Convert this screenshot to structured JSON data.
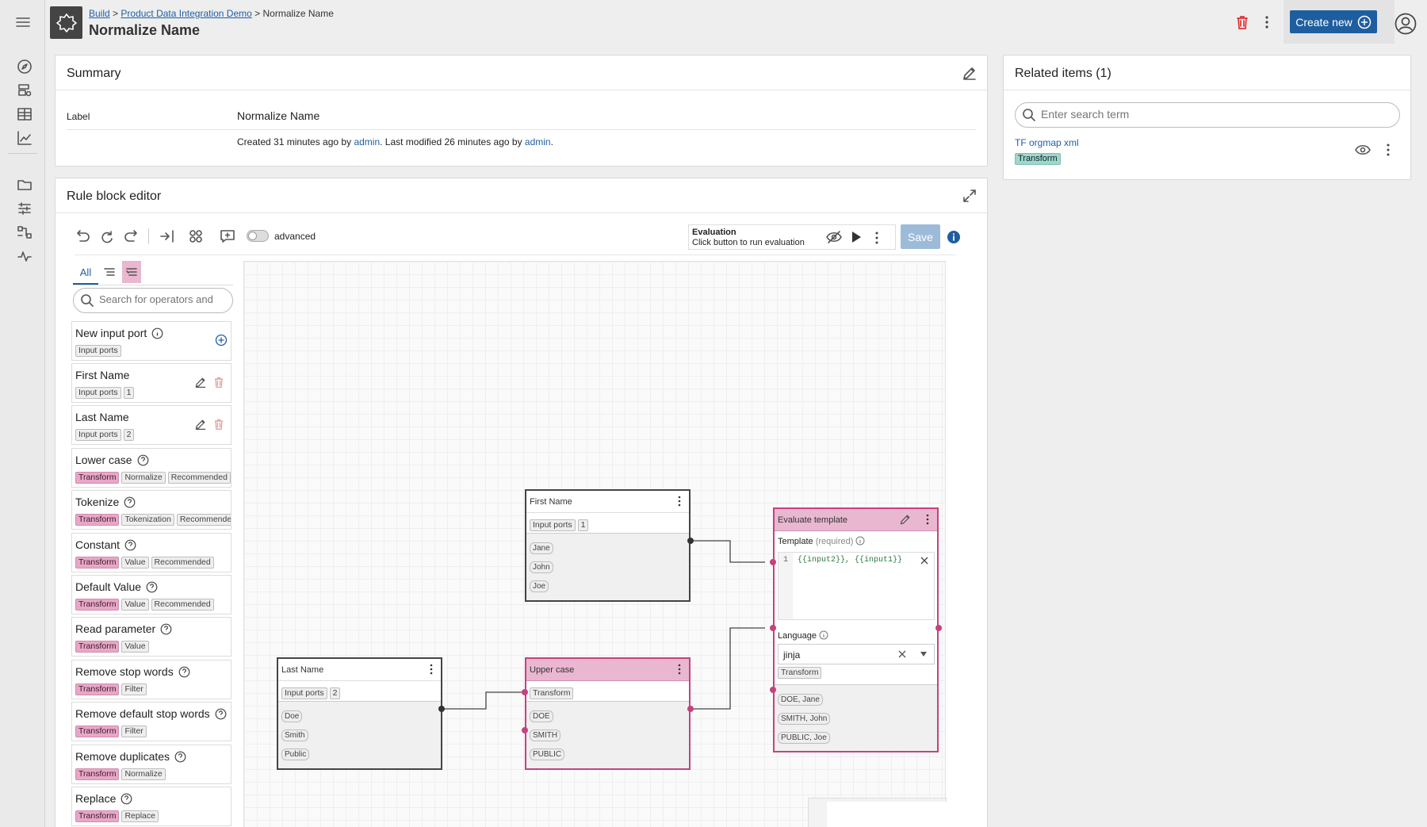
{
  "header": {
    "breadcrumb": [
      "Build",
      "Product Data Integration Demo",
      "Normalize Name"
    ],
    "breadcrumb_sep": ">",
    "title": "Normalize Name",
    "create_label": "Create new"
  },
  "summary": {
    "title": "Summary",
    "label_key": "Label",
    "label_value": "Normalize Name",
    "meta_prefix": "Created 31 minutes ago by",
    "meta_user1": "admin",
    "meta_mid": ". Last modified 26 minutes ago by",
    "meta_user2": "admin",
    "meta_end": "."
  },
  "related": {
    "title": "Related items (1)",
    "search_placeholder": "Enter search term",
    "item_name": "TF orgmap xml",
    "item_tag": "Transform"
  },
  "editor": {
    "title": "Rule block editor",
    "advanced_label": "advanced",
    "eval_title": "Evaluation",
    "eval_sub": "Click button to run evaluation",
    "save_label": "Save",
    "tab_all": "All",
    "op_search_placeholder": "Search for operators and"
  },
  "operators": [
    {
      "name": "New input port",
      "help": true,
      "tags": [
        {
          "t": "Input ports",
          "c": "gray"
        }
      ],
      "action": "add"
    },
    {
      "name": "First Name",
      "help": false,
      "tags": [
        {
          "t": "Input ports",
          "c": "gray"
        },
        {
          "t": "1",
          "c": "gray"
        }
      ],
      "action": "edit"
    },
    {
      "name": "Last Name",
      "help": false,
      "tags": [
        {
          "t": "Input ports",
          "c": "gray"
        },
        {
          "t": "2",
          "c": "gray"
        }
      ],
      "action": "edit"
    },
    {
      "name": "Lower case",
      "help": true,
      "tags": [
        {
          "t": "Transform",
          "c": "pink"
        },
        {
          "t": "Normalize",
          "c": "gray"
        },
        {
          "t": "Recommended",
          "c": "gray"
        }
      ],
      "action": ""
    },
    {
      "name": "Tokenize",
      "help": true,
      "tags": [
        {
          "t": "Transform",
          "c": "pink"
        },
        {
          "t": "Tokenization",
          "c": "gray"
        },
        {
          "t": "Recommended",
          "c": "gray"
        }
      ],
      "action": ""
    },
    {
      "name": "Constant",
      "help": true,
      "tags": [
        {
          "t": "Transform",
          "c": "pink"
        },
        {
          "t": "Value",
          "c": "gray"
        },
        {
          "t": "Recommended",
          "c": "gray"
        }
      ],
      "action": ""
    },
    {
      "name": "Default Value",
      "help": true,
      "tags": [
        {
          "t": "Transform",
          "c": "pink"
        },
        {
          "t": "Value",
          "c": "gray"
        },
        {
          "t": "Recommended",
          "c": "gray"
        }
      ],
      "action": ""
    },
    {
      "name": "Read parameter",
      "help": true,
      "tags": [
        {
          "t": "Transform",
          "c": "pink"
        },
        {
          "t": "Value",
          "c": "gray"
        }
      ],
      "action": ""
    },
    {
      "name": "Remove stop words",
      "help": true,
      "tags": [
        {
          "t": "Transform",
          "c": "pink"
        },
        {
          "t": "Filter",
          "c": "gray"
        }
      ],
      "action": ""
    },
    {
      "name": "Remove default stop words",
      "help": true,
      "tags": [
        {
          "t": "Transform",
          "c": "pink"
        },
        {
          "t": "Filter",
          "c": "gray"
        }
      ],
      "action": ""
    },
    {
      "name": "Remove duplicates",
      "help": true,
      "tags": [
        {
          "t": "Transform",
          "c": "pink"
        },
        {
          "t": "Normalize",
          "c": "gray"
        }
      ],
      "action": ""
    },
    {
      "name": "Replace",
      "help": true,
      "tags": [
        {
          "t": "Transform",
          "c": "pink"
        },
        {
          "t": "Replace",
          "c": "gray"
        }
      ],
      "action": ""
    }
  ],
  "nodes": {
    "first": {
      "title": "First Name",
      "tags": [
        "Input ports",
        "1"
      ],
      "values": [
        "Jane",
        "John",
        "Joe"
      ]
    },
    "last": {
      "title": "Last Name",
      "tags": [
        "Input ports",
        "2"
      ],
      "values": [
        "Doe",
        "Smith",
        "Public"
      ]
    },
    "upper": {
      "title": "Upper case",
      "tags": [
        "Transform"
      ],
      "values": [
        "DOE",
        "SMITH",
        "PUBLIC"
      ]
    },
    "template": {
      "title": "Evaluate template",
      "template_label": "Template",
      "template_req": "(required)",
      "line_no": "1",
      "code": "{{input2}}, {{input1}}",
      "language_label": "Language",
      "language_value": "jinja",
      "lang_tag": "Transform",
      "values": [
        "DOE, Jane",
        "SMITH, John",
        "PUBLIC, Joe"
      ]
    }
  },
  "colors": {
    "accent": "#1e5ea0",
    "pink": "#c4437e",
    "teal": "#9fd7c9"
  }
}
